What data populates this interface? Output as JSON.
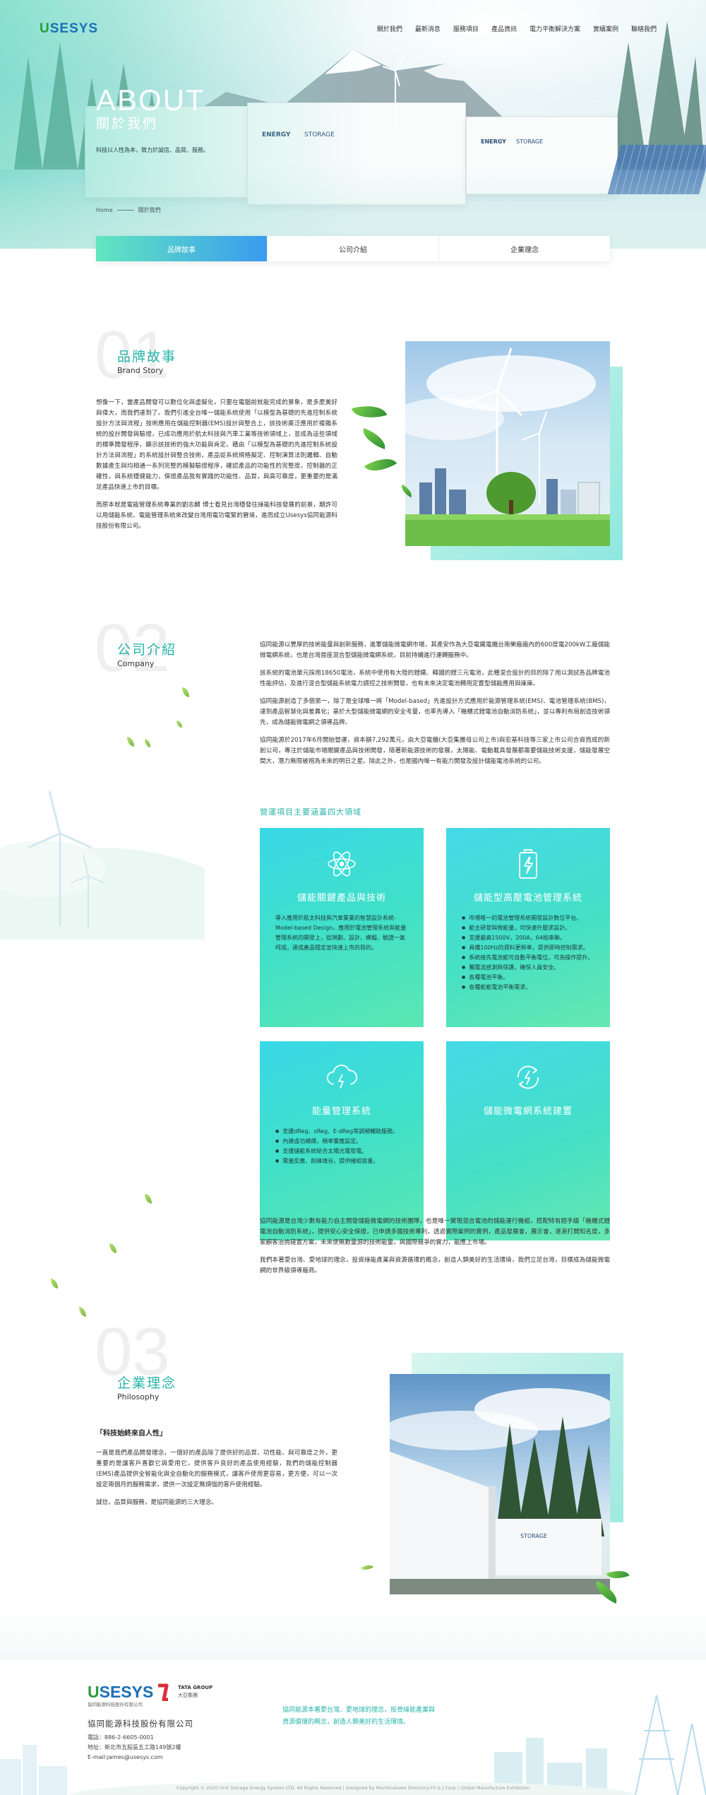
{
  "header": {
    "logo_prefix": "U",
    "logo_main": "SESYS",
    "nav": [
      "關於我們",
      "最新消息",
      "服務項目",
      "產品資訊",
      "電力平衡解決方案",
      "實績案例",
      "聯絡我們"
    ]
  },
  "hero": {
    "title_en": "ABOUT",
    "title_zh": "關於我們",
    "subtitle": "科技以人性為本，致力於誠信、品質、服務。",
    "breadcrumb_home": "Home",
    "breadcrumb_current": "關於我們",
    "container_label": "ENERGY",
    "container_label2": "STORAGE"
  },
  "tabs": [
    "品牌故事",
    "公司介紹",
    "企業理念"
  ],
  "brand": {
    "num": "01",
    "title_zh": "品牌故事",
    "title_en": "Brand Story",
    "paragraphs": [
      "想像一下，當產品開發可以數位化與虛擬化，只要在電腦前就能完成的景象，是多麼美好與偉大，而我們達到了。我們引進全台唯一儲能系統使用「以模型為基礎的先進控制系統設計方法與流程」技術應用在儲能控制器(EMS)設計與整合上，該技術廣泛應用於複雜系統的設計開發與驗證，已成功應用於航太科技與汽車工業等技術領域上，並成為這些領域的標準開發程序，顯示該技術的強大功能與肯定。藉由「以模型為基礎的先進控制系統設計方法與流程」的系統設計與整合技術，產品從系統規格擬定、控制演算法則邏輯、自動數據產生與均相通一系列完整的模擬驗證程序，確認產品的功能性的完整度，控制器的正確性，與系統穩健能力，保證產品我有實踐的功能性、品質，與高可靠度，更重要的是滿足產品快速上市的目標。",
      "而原本就是電能管理系統專業的劉志麟 博士看見台灣穩發往綠能科技發展的前景，期許可以用儲能系統、電能管理系統來改變台灣用電功電緊的窘境，進而成立Usesys協同能源科技股份有限公司。"
    ]
  },
  "company": {
    "num": "02",
    "title_zh": "公司介紹",
    "title_en": "Company",
    "paragraphs": [
      "協同能源以豐厚的技術能量與創新服務，進軍儲能微電網市場，其產安作為大亞電鐵電纜台南樂廠廠內的600度電200kW工廠儲能微電網系統，也是台灣首座混合型儲能微電網系統，目前持續進行運轉服務中。",
      "該系統的電池單元採用18650電池，系統中使用有大陸的鋰鐵、韓國的鋰三元電池，此種混合設計的目的除了用以測試各品牌電池性能評估，及進行混合型儲能系統電力調控之技術開發，也有未來決定電池轉用定置型儲能應用與庫庫。",
      "協同能源創造了多個第一，除了是全球唯一將「Model-based」先進設計方式應用於能源管理系統(EMS)、電池管理系統(BMS)，達到產品智慧化與差異化；基於大型儲能微電網的安全考量，也率先導入「機櫃式鋰電池自動消防系統」，並以專利布局創造技術領先，成為儲能微電網之領導品牌。",
      "協同能源於2017年6月開始營運，資本額7,292萬元，由大亞電纜(大亞集團母公司上市)與宏基科技等三家上市公司合資而成的新創公司，專注於儲能市場關鍵產品與技術開發，隨著新能源技術的發展，太陽能、電動載具發展都需要儲能技術支援，儲能發展空間大，潛力無限被視為未來的明日之星。除此之外，也是國內唯一有能力開發及設計儲能電池系統的公司。"
    ],
    "domains_title": "營運項目主要涵蓋四大領域",
    "cards": [
      {
        "title": "儲能關鍵產品與技術",
        "text": "導入應用於航太科技與汽車業業的智慧設計系統-Model-based Design，應用於電池管理系統與能量管理系統的開發上，從規劃、設計、模擬、驗證一氣呵成，達成產品穩定並快速上市的目的。",
        "icon": "atom-icon"
      },
      {
        "title": "儲能型高壓電池管理系統",
        "items": [
          "市場唯一的電池管理系統開發設計數位平台。",
          "能主研發與微能量，可快速升壓求設計。",
          "支援最高1500V，200A，64組串聯。",
          "具備100Hz的資料更新率，提供即時控制需求。",
          "系統接先電池能可自動平衡電位，可為操作提升。",
          "獨電流感測與保護，確保人員安全。",
          "各種電池平衡。",
          "各種能能電池平衡需求。"
        ],
        "icon": "battery-icon"
      },
      {
        "title": "能量管理系統",
        "items": [
          "支援dReg、sReg、E-dReg等調頻輔助服務。",
          "內建虛功補償，頻率響應設定。",
          "支援儲能系統結合太陽光電發電。",
          "需量反應、削峰填谷，提供機組容量。"
        ],
        "icon": "cloud-power-icon"
      },
      {
        "title": "儲能微電網系統建置",
        "text": "",
        "icon": "recycle-power-icon"
      }
    ],
    "closing": [
      "協同能源是台灣少數有能力自主開發儲能微電網的技術團隊，也是唯一實現混合電池的儲能運行機組，搭配特有超手級「機櫃式鋰電池自動消防系統」，提供安心安全保證，已申請多國技術專利，透過實際案例的實例，產品發展會，展示會，逐漸打開知名度，多家顧客治詢建置方案，未來使無數量源的技術能量，與國際競爭的實力，能應上市場。",
      "我們本著愛台灣、愛地球的理念，投資綠能產業與資源循環的概念，創造人類美好的生活環境，我們立足台灣，目標成為儲能微電網的世界級領導廠商。"
    ]
  },
  "philosophy": {
    "num": "03",
    "title_zh": "企業理念",
    "title_en": "Philosophy",
    "motto": "「科技始終來自人性」",
    "paragraphs": [
      "一直是我們產品開發理念，一個好的產品除了提供好的品質、功性能、與可靠度之外，更重要的是讓客戶喜歡它與愛用它，提供客戶良好的產品使用經驗，我們的儲能控制器(EMS)產品提供全智能化與全自動化的服務模式，讓客戶使用更容易，更方便，可以一次設定兩個月的服務需求，提供一次設定無煩惱的客戶使用經驗。",
      "誠信，品質與服務，是協同能源的三大理念。"
    ]
  },
  "footer": {
    "logo_prefix": "U",
    "logo_main": "SESYS",
    "logo_sub": "協同能源科技股份有限公司",
    "group_label": "TATA GROUP",
    "group_label_zh": "大亞集團",
    "company": "協同能源科技股份有限公司",
    "phone": "電話：886-2-6605-0001",
    "address": "地址：新北市五股區五工路149號2樓",
    "email": "E-mail:james@usesys.com",
    "slogan": [
      "協同能源本著愛台灣、愛地球的理念，投資綠能產業與",
      "資源循環的概念，創造人類美好的生活環境。"
    ],
    "copyright": "Copyright © 2020 Unit Storage Energy System LTD. All Rights Reserved | Designed by Muchinatewx Directory-Fli & J Corp | Global Manufacture Exhibition"
  },
  "colors": {
    "accent": "#27b4a9",
    "tab_gradient_start": "#62e6c0",
    "tab_gradient_end": "#3a9bf0",
    "card_gradient": "#40e0c8"
  }
}
